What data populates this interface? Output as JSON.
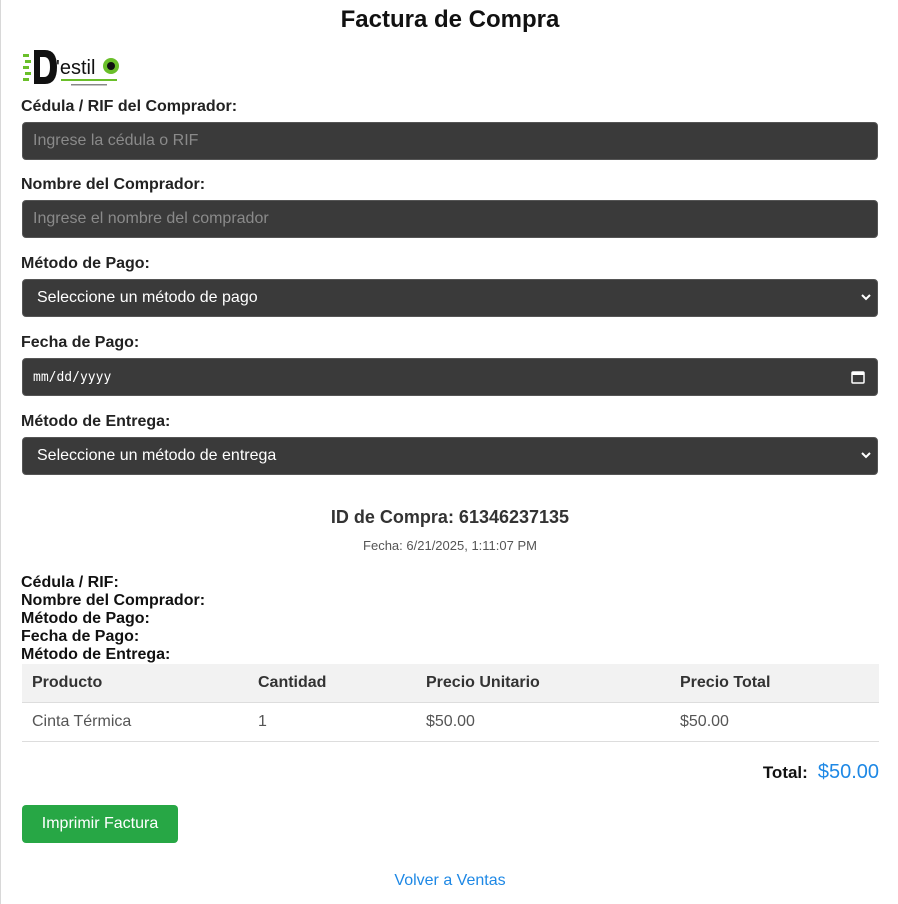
{
  "title": "Factura de Compra",
  "logo": {
    "text": "D'estilo"
  },
  "form": {
    "cedula": {
      "label": "Cédula / RIF del Comprador:",
      "placeholder": "Ingrese la cédula o RIF",
      "value": ""
    },
    "nombre": {
      "label": "Nombre del Comprador:",
      "placeholder": "Ingrese el nombre del comprador",
      "value": ""
    },
    "metodo_pago": {
      "label": "Método de Pago:",
      "selected": "Seleccione un método de pago"
    },
    "fecha_pago": {
      "label": "Fecha de Pago:",
      "value": "mm/dd/yyyy"
    },
    "metodo_entrega": {
      "label": "Método de Entrega:",
      "selected": "Seleccione un método de entrega"
    }
  },
  "invoice": {
    "purchase_id": "ID de Compra: 61346237135",
    "date": "Fecha: 6/21/2025, 1:11:07 PM",
    "summary": [
      "Cédula / RIF:",
      "Nombre del Comprador:",
      "Método de Pago:",
      "Fecha de Pago:",
      "Método de Entrega:"
    ]
  },
  "table": {
    "headers": [
      "Producto",
      "Cantidad",
      "Precio Unitario",
      "Precio Total"
    ],
    "rows": [
      [
        "Cinta Térmica",
        "1",
        "$50.00",
        "$50.00"
      ]
    ]
  },
  "total": {
    "label": "Total:",
    "value": "$50.00"
  },
  "actions": {
    "print_label": "Imprimir Factura",
    "back_label": "Volver a Ventas"
  },
  "colors": {
    "field_bg": "#3a3a3a",
    "accent_blue": "#1e88e5",
    "button_green": "#27a745"
  }
}
